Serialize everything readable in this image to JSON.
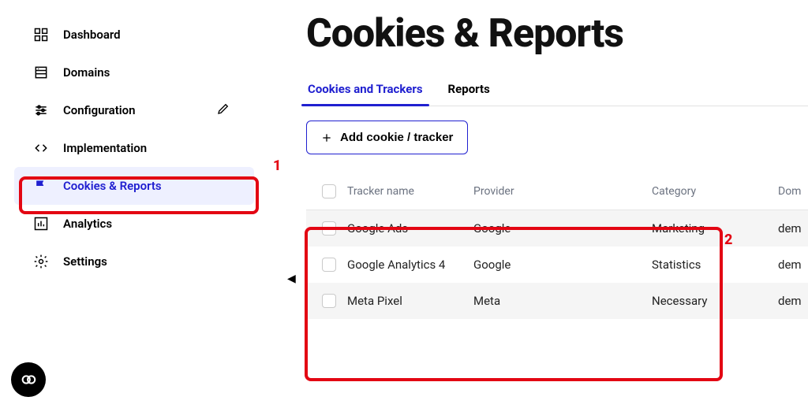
{
  "sidebar": {
    "items": [
      {
        "label": "Dashboard"
      },
      {
        "label": "Domains"
      },
      {
        "label": "Configuration"
      },
      {
        "label": "Implementation"
      },
      {
        "label": "Cookies & Reports"
      },
      {
        "label": "Analytics"
      },
      {
        "label": "Settings"
      }
    ]
  },
  "page": {
    "title": "Cookies & Reports"
  },
  "tabs": [
    {
      "label": "Cookies and Trackers"
    },
    {
      "label": "Reports"
    }
  ],
  "addButton": {
    "label": "Add cookie / tracker"
  },
  "table": {
    "headers": {
      "name": "Tracker name",
      "provider": "Provider",
      "category": "Category",
      "domain": "Dom"
    },
    "rows": [
      {
        "name": "Google Ads",
        "provider": "Google",
        "category": "Marketing",
        "domain": "dem"
      },
      {
        "name": "Google Analytics 4",
        "provider": "Google",
        "category": "Statistics",
        "domain": "dem"
      },
      {
        "name": "Meta Pixel",
        "provider": "Meta",
        "category": "Necessary",
        "domain": "dem"
      }
    ]
  },
  "annotations": {
    "one": "1",
    "two": "2"
  }
}
